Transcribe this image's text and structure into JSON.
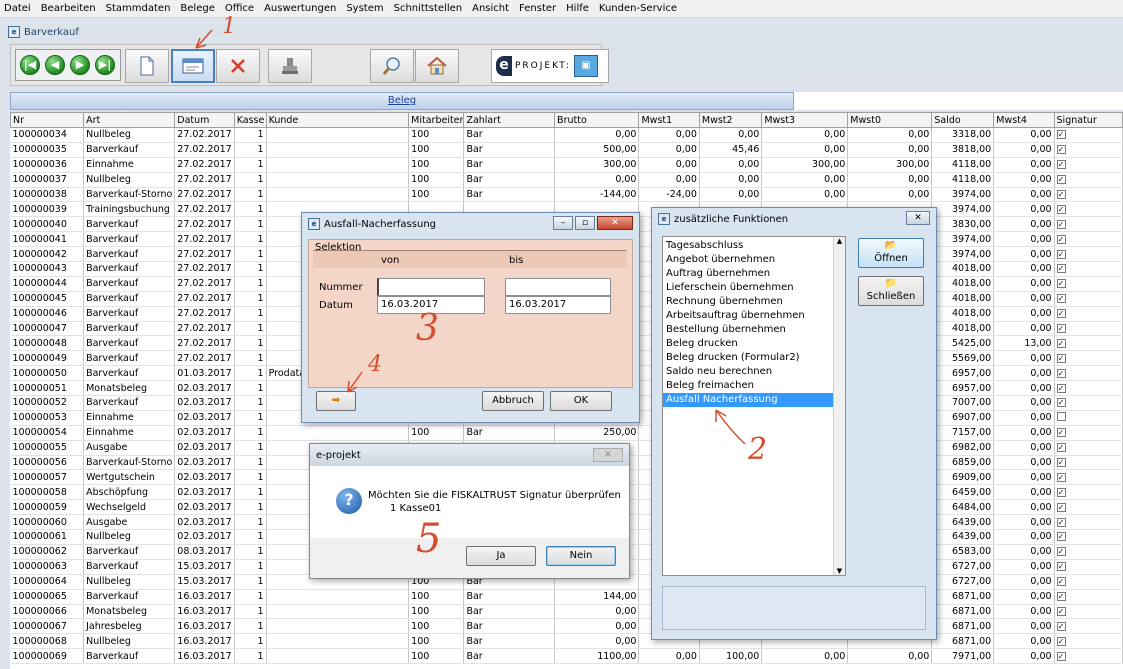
{
  "menu": [
    "Datei",
    "Bearbeiten",
    "Stammdaten",
    "Belege",
    "Office",
    "Auswertungen",
    "System",
    "Schnittstellen",
    "Ansicht",
    "Fenster",
    "Hilfe",
    "Kunden-Service"
  ],
  "window_title": "Barverkauf",
  "app_icon": "e",
  "toolbar": {
    "nav": [
      "|◀",
      "◀",
      "▶",
      "▶|"
    ],
    "buttons": [
      "new-doc-icon",
      "edit-form-icon",
      "delete-icon",
      "stamp-icon",
      "search-icon",
      "home-icon"
    ],
    "eprojekt_label": "PROJEKT:"
  },
  "beleg_tab": "Beleg",
  "grid": {
    "columns": [
      "Nr",
      "Art",
      "Datum",
      "Kasse",
      "Kunde",
      "Mitarbeiter",
      "Zahlart",
      "Brutto",
      "Mwst1",
      "Mwst2",
      "Mwst3",
      "Mwst0",
      "Saldo",
      "Mwst4",
      "Signatur"
    ],
    "rows": [
      [
        "100000034",
        "Nullbeleg",
        "27.02.2017",
        "1",
        "",
        "100",
        "Bar",
        "0,00",
        "0,00",
        "0,00",
        "0,00",
        "0,00",
        "3318,00",
        "0,00",
        "✓"
      ],
      [
        "100000035",
        "Barverkauf",
        "27.02.2017",
        "1",
        "",
        "100",
        "Bar",
        "500,00",
        "0,00",
        "45,46",
        "0,00",
        "0,00",
        "3818,00",
        "0,00",
        "✓"
      ],
      [
        "100000036",
        "Einnahme",
        "27.02.2017",
        "1",
        "",
        "100",
        "Bar",
        "300,00",
        "0,00",
        "0,00",
        "300,00",
        "300,00",
        "4118,00",
        "0,00",
        "✓"
      ],
      [
        "100000037",
        "Nullbeleg",
        "27.02.2017",
        "1",
        "",
        "100",
        "Bar",
        "0,00",
        "0,00",
        "0,00",
        "0,00",
        "0,00",
        "4118,00",
        "0,00",
        "✓"
      ],
      [
        "100000038",
        "Barverkauf-Storno",
        "27.02.2017",
        "1",
        "",
        "100",
        "Bar",
        "-144,00",
        "-24,00",
        "0,00",
        "0,00",
        "0,00",
        "3974,00",
        "0,00",
        "✓"
      ],
      [
        "100000039",
        "Trainingsbuchung",
        "27.02.2017",
        "1",
        "",
        "",
        "",
        "",
        "",
        "",
        "",
        "",
        "3974,00",
        "0,00",
        "✓"
      ],
      [
        "100000040",
        "Barverkauf",
        "27.02.2017",
        "1",
        "",
        "",
        "",
        "",
        "",
        "",
        "",
        "",
        "3830,00",
        "0,00",
        "✓"
      ],
      [
        "100000041",
        "Barverkauf",
        "27.02.2017",
        "1",
        "",
        "",
        "",
        "",
        "",
        "",
        "",
        "",
        "3974,00",
        "0,00",
        "✓"
      ],
      [
        "100000042",
        "Barverkauf",
        "27.02.2017",
        "1",
        "",
        "",
        "",
        "",
        "",
        "",
        "",
        "",
        "3974,00",
        "0,00",
        "✓"
      ],
      [
        "100000043",
        "Barverkauf",
        "27.02.2017",
        "1",
        "",
        "",
        "",
        "",
        "",
        "",
        "",
        "",
        "4018,00",
        "0,00",
        "✓"
      ],
      [
        "100000044",
        "Barverkauf",
        "27.02.2017",
        "1",
        "",
        "",
        "",
        "",
        "",
        "",
        "",
        "",
        "4018,00",
        "0,00",
        "✓"
      ],
      [
        "100000045",
        "Barverkauf",
        "27.02.2017",
        "1",
        "",
        "",
        "",
        "",
        "",
        "",
        "",
        "",
        "4018,00",
        "0,00",
        "✓"
      ],
      [
        "100000046",
        "Barverkauf",
        "27.02.2017",
        "1",
        "",
        "",
        "",
        "",
        "",
        "",
        "",
        "",
        "4018,00",
        "0,00",
        "✓"
      ],
      [
        "100000047",
        "Barverkauf",
        "27.02.2017",
        "1",
        "",
        "",
        "",
        "",
        "",
        "",
        "",
        "",
        "4018,00",
        "0,00",
        "✓"
      ],
      [
        "100000048",
        "Barverkauf",
        "27.02.2017",
        "1",
        "",
        "",
        "",
        "",
        "",
        "",
        "",
        "",
        "5425,00",
        "13,00",
        "✓"
      ],
      [
        "100000049",
        "Barverkauf",
        "27.02.2017",
        "1",
        "",
        "",
        "",
        "",
        "",
        "",
        "",
        "",
        "5569,00",
        "0,00",
        "✓"
      ],
      [
        "100000050",
        "Barverkauf",
        "01.03.2017",
        "1",
        "Prodata Ha",
        "",
        "",
        "",
        "",
        "",
        "",
        "",
        "6957,00",
        "0,00",
        "✓"
      ],
      [
        "100000051",
        "Monatsbeleg",
        "02.03.2017",
        "1",
        "",
        "",
        "",
        "",
        "",
        "",
        "",
        "",
        "6957,00",
        "0,00",
        "✓"
      ],
      [
        "100000052",
        "Barverkauf",
        "02.03.2017",
        "1",
        "",
        "",
        "",
        "",
        "",
        "",
        "",
        "",
        "7007,00",
        "0,00",
        "✓"
      ],
      [
        "100000053",
        "Einnahme",
        "02.03.2017",
        "1",
        "",
        "",
        "",
        "",
        "",
        "",
        "",
        "",
        "6907,00",
        "0,00",
        ""
      ],
      [
        "100000054",
        "Einnahme",
        "02.03.2017",
        "1",
        "",
        "100",
        "Bar",
        "250,00",
        "",
        "",
        "",
        "",
        "7157,00",
        "0,00",
        "✓"
      ],
      [
        "100000055",
        "Ausgabe",
        "02.03.2017",
        "1",
        "",
        "",
        "",
        "",
        "",
        "",
        "",
        "",
        "6982,00",
        "0,00",
        "✓"
      ],
      [
        "100000056",
        "Barverkauf-Storno",
        "02.03.2017",
        "1",
        "",
        "",
        "",
        "",
        "",
        "",
        "",
        "",
        "6859,00",
        "0,00",
        "✓"
      ],
      [
        "100000057",
        "Wertgutschein",
        "02.03.2017",
        "1",
        "",
        "",
        "",
        "",
        "",
        "",
        "",
        "",
        "6909,00",
        "0,00",
        "✓"
      ],
      [
        "100000058",
        "Abschöpfung",
        "02.03.2017",
        "1",
        "",
        "",
        "",
        "",
        "",
        "",
        "",
        "",
        "6459,00",
        "0,00",
        "✓"
      ],
      [
        "100000059",
        "Wechselgeld",
        "02.03.2017",
        "1",
        "",
        "",
        "",
        "",
        "",
        "",
        "",
        "",
        "6484,00",
        "0,00",
        "✓"
      ],
      [
        "100000060",
        "Ausgabe",
        "02.03.2017",
        "1",
        "",
        "",
        "",
        "",
        "",
        "",
        "",
        "",
        "6439,00",
        "0,00",
        "✓"
      ],
      [
        "100000061",
        "Nullbeleg",
        "02.03.2017",
        "1",
        "",
        "",
        "",
        "",
        "",
        "",
        "",
        "",
        "6439,00",
        "0,00",
        "✓"
      ],
      [
        "100000062",
        "Barverkauf",
        "08.03.2017",
        "1",
        "",
        "",
        "",
        "",
        "",
        "",
        "",
        "",
        "6583,00",
        "0,00",
        "✓"
      ],
      [
        "100000063",
        "Barverkauf",
        "15.03.2017",
        "1",
        "",
        "",
        "",
        "",
        "",
        "",
        "",
        "",
        "6727,00",
        "0,00",
        "✓"
      ],
      [
        "100000064",
        "Nullbeleg",
        "15.03.2017",
        "1",
        "",
        "100",
        "Bar",
        "",
        "",
        "",
        "",
        "",
        "6727,00",
        "0,00",
        "✓"
      ],
      [
        "100000065",
        "Barverkauf",
        "16.03.2017",
        "1",
        "",
        "100",
        "Bar",
        "144,00",
        "",
        "",
        "",
        "",
        "6871,00",
        "0,00",
        "✓"
      ],
      [
        "100000066",
        "Monatsbeleg",
        "16.03.2017",
        "1",
        "",
        "100",
        "Bar",
        "0,00",
        "",
        "",
        "",
        "",
        "6871,00",
        "0,00",
        "✓"
      ],
      [
        "100000067",
        "Jahresbeleg",
        "16.03.2017",
        "1",
        "",
        "100",
        "Bar",
        "0,00",
        "",
        "",
        "",
        "",
        "6871,00",
        "0,00",
        "✓"
      ],
      [
        "100000068",
        "Nullbeleg",
        "16.03.2017",
        "1",
        "",
        "100",
        "Bar",
        "0,00",
        "",
        "",
        "",
        "",
        "6871,00",
        "0,00",
        "✓"
      ],
      [
        "100000069",
        "Barverkauf",
        "16.03.2017",
        "1",
        "",
        "100",
        "Bar",
        "1100,00",
        "0,00",
        "100,00",
        "0,00",
        "0,00",
        "7971,00",
        "0,00",
        "✓"
      ]
    ]
  },
  "dlg_nacherfassung": {
    "title": "Ausfall-Nacherfassung",
    "group": "Selektion",
    "col_von": "von",
    "col_bis": "bis",
    "label_nummer": "Nummer",
    "label_datum": "Datum",
    "nummer_von": "",
    "nummer_bis": "",
    "datum_von": "16.03.2017",
    "datum_bis": "16.03.2017",
    "btn_arrow": "➡",
    "btn_abbruch": "Abbruch",
    "btn_ok": "OK"
  },
  "dlg_funktionen": {
    "title": "zusätzliche Funktionen",
    "items": [
      "Tagesabschluss",
      "Angebot übernehmen",
      "Auftrag übernehmen",
      "Lieferschein übernehmen",
      "Rechnung übernehmen",
      "Arbeitsauftrag übernehmen",
      "Bestellung übernehmen",
      "Beleg drucken",
      "Beleg drucken (Formular2)",
      "Saldo neu berechnen",
      "Beleg freimachen",
      "Ausfall Nacherfassung"
    ],
    "selected_index": 11,
    "btn_oeffnen": "Öffnen",
    "btn_schliessen": "Schließen"
  },
  "dlg_confirm": {
    "title": "e-projekt",
    "message": "Möchten Sie die FISKALTRUST Signatur überprüfen",
    "detail": "1 Kasse01",
    "btn_ja": "Ja",
    "btn_nein": "Nein"
  },
  "annotations": [
    "1",
    "2",
    "3",
    "4",
    "5"
  ],
  "colors": {
    "selection": "#3399ff",
    "dialog_bg": "#d9e4f1",
    "form_bg": "#f3d6c8",
    "annotation": "#d2502e"
  }
}
